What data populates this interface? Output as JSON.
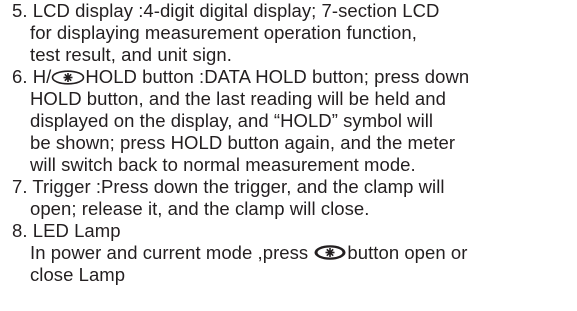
{
  "items": [
    {
      "num": "5.",
      "lines": [
        "LCD display :4-digit digital display; 7-section LCD",
        "for displaying measurement operation function,",
        "test result, and unit sign."
      ]
    },
    {
      "num": "6.",
      "first_a": "H/",
      "first_b": "HOLD button :DATA HOLD button; press down",
      "lines": [
        "HOLD button, and the last reading will be held and",
        "displayed on the display, and “HOLD” symbol will",
        "be shown; press HOLD button again, and the meter",
        "will switch back to normal measurement mode."
      ]
    },
    {
      "num": "7.",
      "lines": [
        "Trigger :Press down the trigger, and the clamp will",
        "open; release it, and the clamp will close."
      ]
    },
    {
      "num": "8.",
      "title": "LED Lamp",
      "line2_a": "In power and current mode ,press",
      "line2_b": "button open or",
      "line3": "close Lamp"
    }
  ],
  "icons": {
    "backlight": "backlight-button-icon",
    "lamp": "lamp-button-icon"
  },
  "colors": {
    "text": "#231f20",
    "background": "#ffffff"
  }
}
